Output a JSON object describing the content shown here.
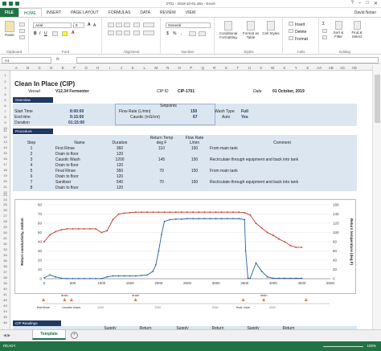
{
  "titlebar": {
    "title": "2701 - 2018-10-01.xlsx - Excel",
    "controls": [
      "?",
      "–",
      "□",
      "✕"
    ]
  },
  "tabs": {
    "file": "FILE",
    "items": [
      "HOME",
      "INSERT",
      "PAGE LAYOUT",
      "FORMULAS",
      "DATA",
      "REVIEW",
      "VIEW"
    ],
    "user": "David Nolan"
  },
  "ribbon": {
    "paste": "Paste",
    "clipboard": "Clipboard",
    "font_name": "Arial",
    "font_size": "8",
    "font_group": "Font",
    "alignment": "Alignment",
    "number_format": "General",
    "number_group": "Number",
    "conditional": "Conditional Formatting",
    "format_table": "Format as Table",
    "cell_styles": "Cell Styles",
    "styles_group": "Styles",
    "insert": "Insert",
    "delete": "Delete",
    "format": "Format",
    "cells_group": "Cells",
    "sort_filter": "Sort & Filter",
    "find_select": "Find & Select",
    "editing_group": "Editing"
  },
  "formula_bar": {
    "name_box": "A1",
    "fx": "fx",
    "value": ""
  },
  "columns": [
    "A",
    "B",
    "C",
    "D",
    "E",
    "F",
    "G",
    "H",
    "I",
    "J",
    "K",
    "L",
    "M",
    "N",
    "O",
    "P",
    "Q",
    "R",
    "S",
    "T",
    "U",
    "V",
    "W",
    "X",
    "Y",
    "Z",
    "AA",
    "AB",
    "AC",
    "AD",
    "AE"
  ],
  "rows": [
    "1",
    "2",
    "3",
    "4",
    "5",
    "6",
    "7",
    "8",
    "9",
    "10",
    "11",
    "12",
    "13",
    "14",
    "15",
    "16",
    "17",
    "18",
    "19",
    "20",
    "21",
    "22",
    "23",
    "24",
    "25",
    "26",
    "27",
    "28",
    "29",
    "30",
    "31",
    "32",
    "33",
    "34",
    "35",
    "36",
    "37",
    "38",
    "39",
    "40",
    "41",
    "42",
    "43",
    "44",
    "45",
    "46"
  ],
  "header": {
    "title": "Clean In Place (CIP)",
    "vessel_label": "Vessel",
    "vessel": "V12.34 Fermenter",
    "cip_id_label": "CIP ID",
    "cip_id": "CIP-1701",
    "date_label": "Date",
    "date": "01 October, 2019"
  },
  "overview": {
    "section": "Overview",
    "setpoints": "Setpoints",
    "start_label": "Start Time",
    "start": "8:00:00",
    "end_label": "End time",
    "end": "9:15:00",
    "duration_label": "Duration",
    "duration": "01:15:00",
    "flow_label": "Flow Rate (L/min)",
    "flow": "150",
    "caustic_label": "Caustic (mS/cm)",
    "caustic": "67",
    "wash_label": "Wash Type",
    "wash": "Full",
    "auto_label": "Auto",
    "auto": "Yes"
  },
  "procedure": {
    "section": "Procedure",
    "headers": [
      "Step",
      "Name",
      "Duration",
      "Return Temp deg F",
      "Flow Rate L/min",
      "Comment"
    ],
    "rows": [
      [
        "1",
        "First Rinse",
        "360",
        "110",
        "150",
        "From main tank"
      ],
      [
        "2",
        "Drain to floor",
        "120",
        "",
        "",
        ""
      ],
      [
        "3",
        "Caustic Wash",
        "1200",
        "145",
        "150",
        "Recirculate through equipment and back into tank"
      ],
      [
        "4",
        "Drain to floor",
        "120",
        "",
        "",
        ""
      ],
      [
        "5",
        "Final Rinse",
        "360",
        "70",
        "150",
        "From main tank"
      ],
      [
        "6",
        "Drain to floor",
        "120",
        "",
        "",
        ""
      ],
      [
        "7",
        "Sanitiser",
        "540",
        "70",
        "150",
        "Recirculate through equipment and back into tank"
      ],
      [
        "8",
        "Drain to floor",
        "120",
        "",
        "",
        ""
      ]
    ]
  },
  "chart_data": {
    "type": "line",
    "ylabel": "Return conductivity, mS/cm",
    "y2label": "Return temperature (deg F)",
    "xlim": [
      0,
      5000
    ],
    "ylim": [
      0,
      80
    ],
    "y2lim": [
      0,
      160
    ],
    "x_ticks": [
      "0",
      "500",
      "1000",
      "1500",
      "2000",
      "2500",
      "3000",
      "3500",
      "4000",
      "4500",
      "5000"
    ],
    "y_ticks": [
      "0",
      "10",
      "20",
      "30",
      "40",
      "50",
      "60",
      "70",
      "80"
    ],
    "y2_ticks": [
      "0",
      "20",
      "40",
      "60",
      "80",
      "100",
      "120",
      "140",
      "160"
    ],
    "grid": true,
    "series": [
      {
        "color": "#2e5fa1",
        "axis": "left",
        "x": [
          0,
          100,
          200,
          300,
          400,
          500,
          600,
          700,
          800,
          900,
          1000,
          1100,
          1200,
          1300,
          1400,
          1500,
          1600,
          1700,
          1800,
          1900,
          1950,
          2000,
          2050,
          2100,
          2200,
          2300,
          2400,
          2500,
          2600,
          2700,
          2800,
          2900,
          3000,
          3100,
          3200,
          3300,
          3400,
          3500,
          3520,
          3560,
          3600,
          3700,
          3800,
          3900,
          4000,
          4100,
          4200,
          4300,
          4400,
          4500
        ],
        "y": [
          1,
          4,
          2,
          0.5,
          0.2,
          0.2,
          0.2,
          0.2,
          0.2,
          0.2,
          0.2,
          2,
          3,
          3,
          3,
          3,
          3,
          3.5,
          4,
          8,
          15,
          30,
          48,
          62,
          64,
          64.5,
          64.5,
          65,
          65,
          65,
          65,
          65,
          65,
          65,
          65,
          65,
          65,
          64,
          30,
          0.5,
          0.5,
          17,
          8,
          2,
          0.5,
          0.5,
          0.5,
          0.5,
          0.5,
          0.5
        ]
      },
      {
        "color": "#c0392b",
        "axis": "right",
        "x": [
          0,
          100,
          200,
          300,
          400,
          500,
          600,
          700,
          800,
          900,
          1000,
          1100,
          1200,
          1300,
          1400,
          1500,
          1600,
          1700,
          1800,
          1900,
          2000,
          2100,
          2200,
          2300,
          2400,
          2500,
          2600,
          2700,
          2800,
          2900,
          3000,
          3100,
          3200,
          3300,
          3400,
          3500,
          3600,
          3700,
          3800,
          3900,
          4000,
          4100,
          4200,
          4300,
          4400,
          4500
        ],
        "y": [
          80,
          95,
          102,
          106,
          108,
          108,
          108,
          108,
          108,
          108,
          100,
          104,
          128,
          140,
          142,
          143,
          144,
          144,
          144,
          144,
          144,
          144,
          144,
          144,
          144,
          144,
          144,
          144,
          144,
          144,
          144,
          144,
          144,
          144,
          144,
          143,
          138,
          120,
          110,
          100,
          94,
          86,
          80,
          72,
          68,
          68
        ]
      }
    ],
    "annotations": [
      {
        "x": 0,
        "label": "first rinse"
      },
      {
        "x": 370,
        "label": "drain"
      },
      {
        "x": 490,
        "label": "caustic wash"
      },
      {
        "x": 1610,
        "label": "drain"
      },
      {
        "x": 3490,
        "label": "final rinse"
      },
      {
        "x": 3850,
        "label": "drain"
      },
      {
        "x": 4590,
        "label": ""
      }
    ],
    "marker_ticks": [
      "0",
      "1000",
      "2000",
      "3000",
      "4000"
    ]
  },
  "readings": {
    "section": "CIP Readings",
    "headers": [
      "Supply",
      "Return",
      "Supply",
      "Return",
      "Supply",
      "Return"
    ]
  },
  "sheets": {
    "active": "Template",
    "add": "+"
  },
  "status": {
    "ready": "READY",
    "zoom": "100%"
  }
}
